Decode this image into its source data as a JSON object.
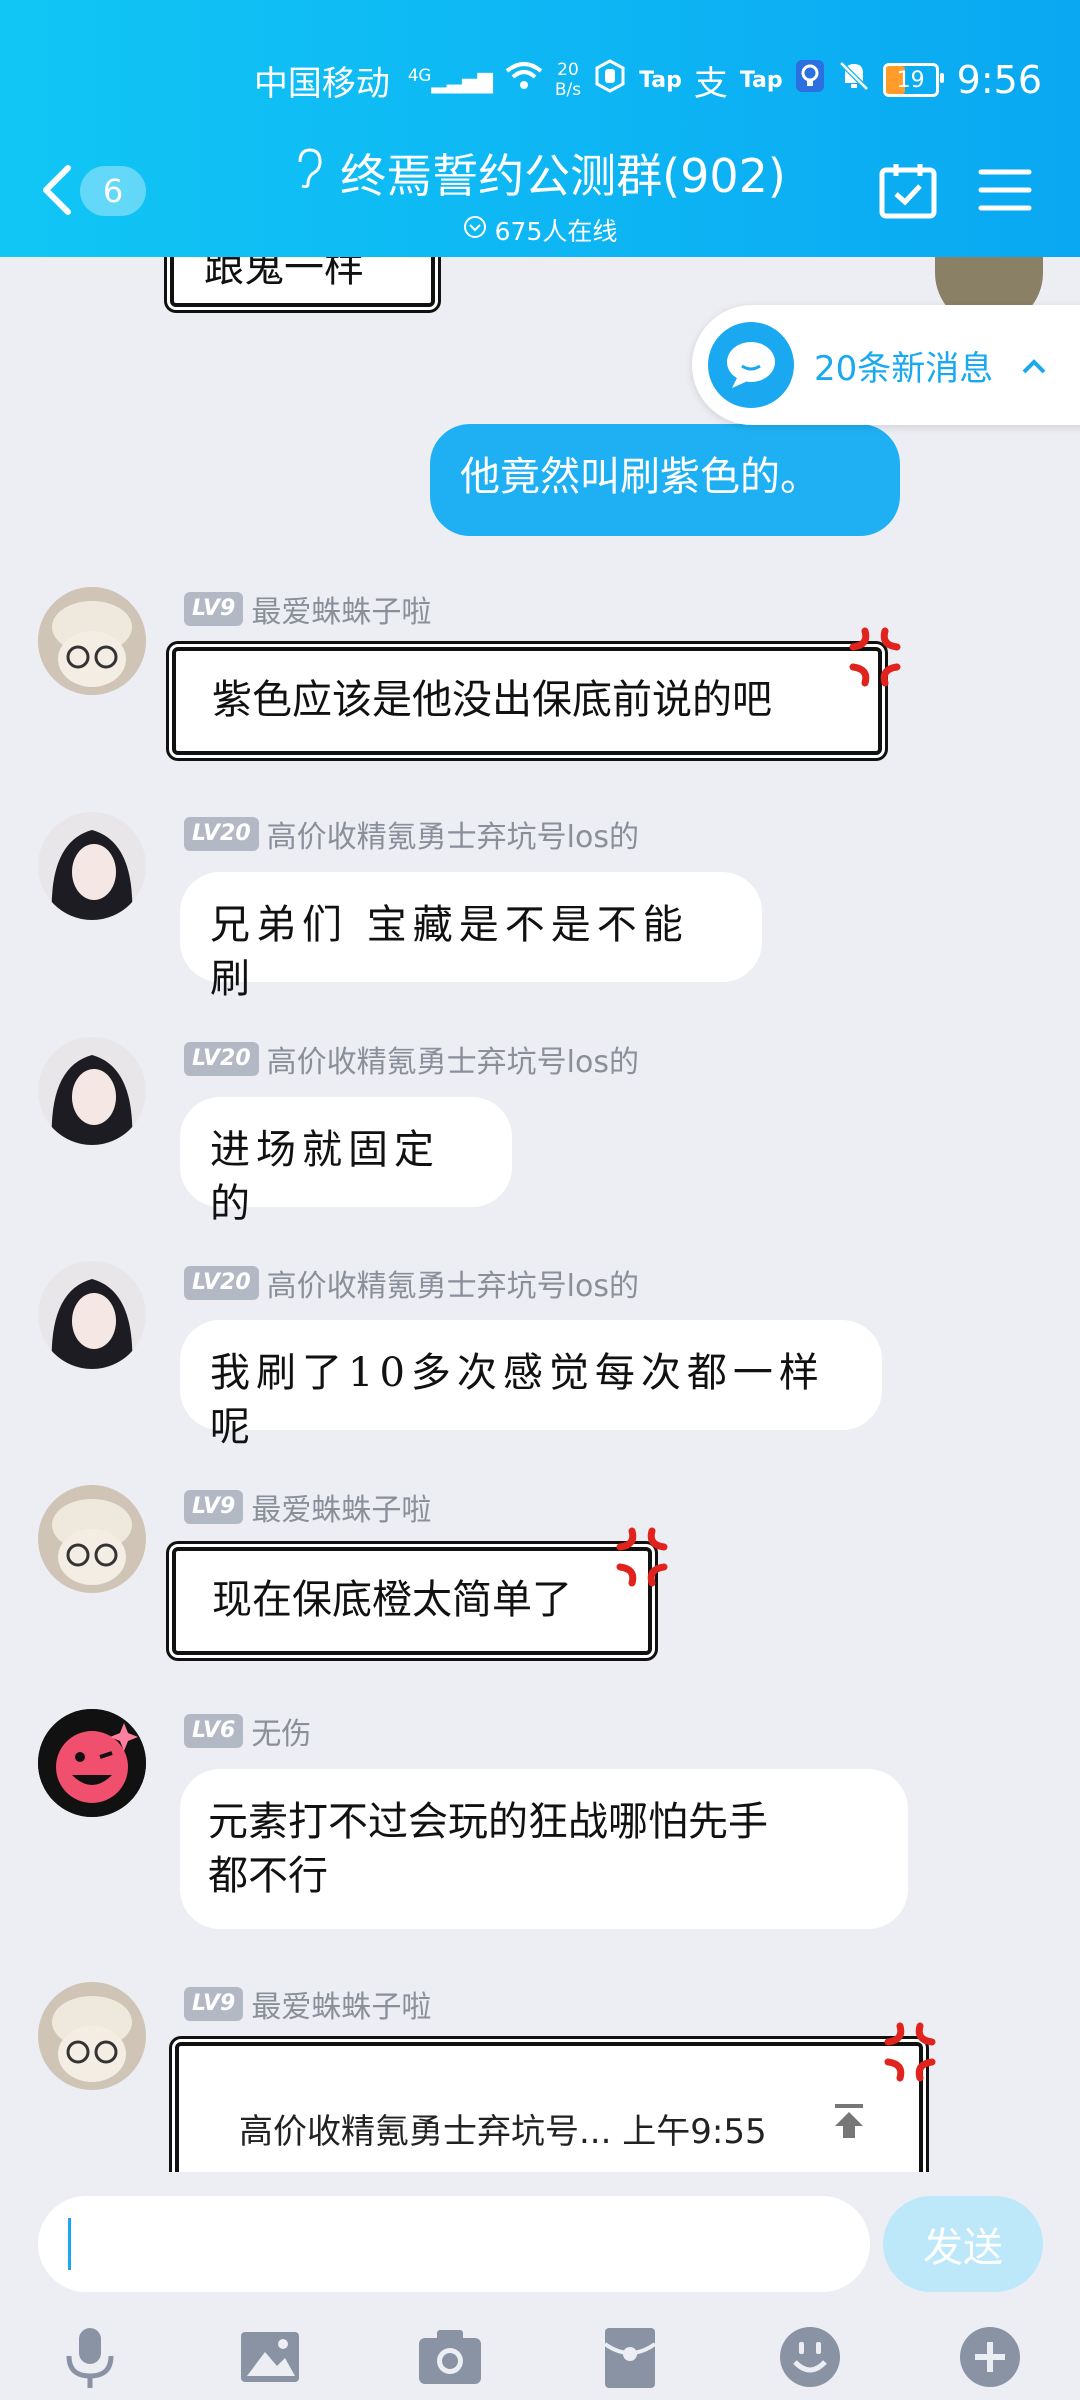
{
  "status_bar": {
    "carrier": "中国移动",
    "network": "4G",
    "speed_value": "20",
    "speed_unit": "B/s",
    "tap1": "Tap",
    "tap2": "Tap",
    "battery": "19",
    "time": "9:56"
  },
  "header": {
    "back_count": "6",
    "title": "终焉誓约公测群(902)",
    "online": "675人在线"
  },
  "new_messages_pill": {
    "text": "20条新消息"
  },
  "messages": [
    {
      "id": "m0",
      "text": "跟鬼一样",
      "style": "comic",
      "partial": true
    },
    {
      "id": "m1",
      "sender": "self",
      "text": "他竟然叫刷紫色的。"
    },
    {
      "id": "m2",
      "level": "LV9",
      "name": "最爱蛛蛛子啦",
      "text": "紫色应该是他没出保底前说的吧",
      "style": "comic"
    },
    {
      "id": "m3",
      "level": "LV20",
      "name": "高价收精氪勇士弃坑号los的",
      "text": "兄弟们 宝藏是不是不能刷",
      "style": "hand"
    },
    {
      "id": "m4",
      "level": "LV20",
      "name": "高价收精氪勇士弃坑号los的",
      "text": "进场就固定的",
      "style": "hand"
    },
    {
      "id": "m5",
      "level": "LV20",
      "name": "高价收精氪勇士弃坑号los的",
      "text": "我刷了10多次感觉每次都一样呢",
      "style": "hand"
    },
    {
      "id": "m6",
      "level": "LV9",
      "name": "最爱蛛蛛子啦",
      "text": "现在保底橙太简单了",
      "style": "comic"
    },
    {
      "id": "m7",
      "level": "LV6",
      "name": "无伤",
      "line1": "元素打不过会玩的狂战哪怕先手",
      "line2": "都不行",
      "style": "plain"
    },
    {
      "id": "m8",
      "level": "LV9",
      "name": "最爱蛛蛛子啦",
      "quote_header": "高价收精氪勇士弃坑号... 上午9:55",
      "style": "comic-quote"
    }
  ],
  "input_bar": {
    "placeholder": "",
    "send_label": "发送"
  },
  "toolbar": [
    "microphone-icon",
    "image-icon",
    "camera-icon",
    "red-packet-icon",
    "emoji-icon",
    "plus-icon"
  ],
  "colors": {
    "accent": "#1aa9f0",
    "header_start": "#11c6f5",
    "self_bubble": "#1fb0f3",
    "background": "#eceef4"
  }
}
